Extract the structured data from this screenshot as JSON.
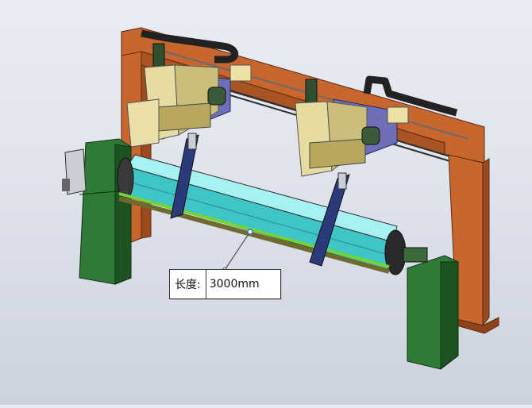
{
  "measurement": {
    "label": "长度:",
    "value": "3000mm"
  },
  "colors": {
    "background_top": "#e9ecf3",
    "frame_orange": "#c8662e",
    "frame_orange_dark": "#8e4418",
    "column_green": "#2f7a35",
    "column_green_dark": "#1c5321",
    "tube_cyan": "#3fc4c8",
    "rod_green": "#72d43a",
    "carriage_tan": "#cbbd7a",
    "plate_purple": "#6e6fb9",
    "cable_chain": "#222222",
    "measure_line": "#555555"
  },
  "icons": {
    "measure_point": "measure-point-icon"
  }
}
